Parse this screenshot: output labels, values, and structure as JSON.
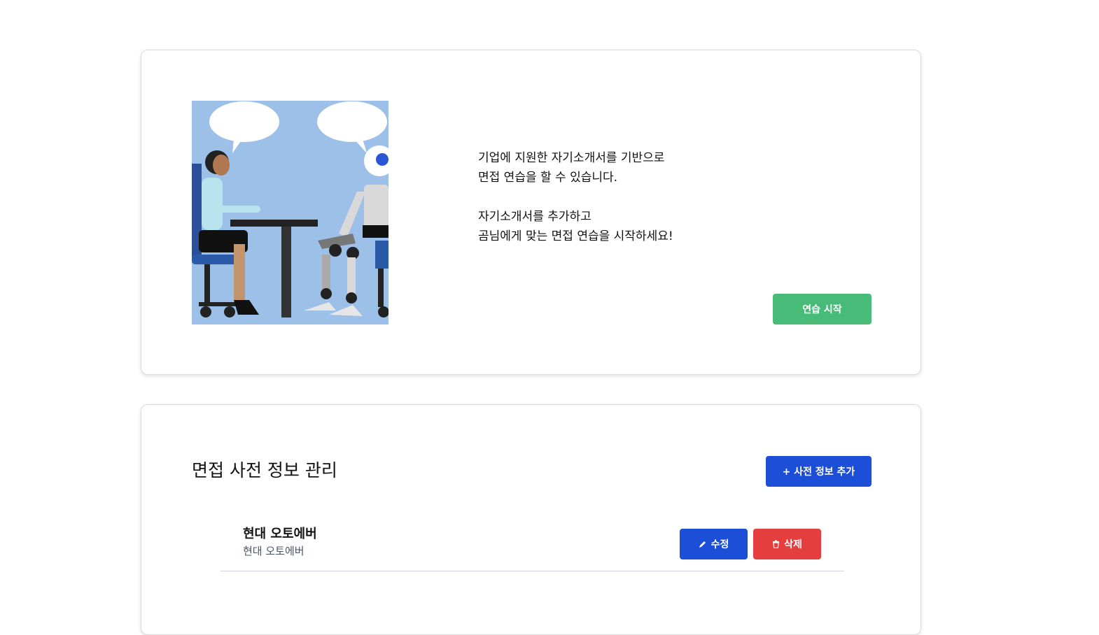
{
  "intro": {
    "illustration_alt": "interview-illustration",
    "lines": [
      "기업에 지원한 자기소개서를 기반으로",
      "면접 연습을 할 수 있습니다.",
      "자기소개서를 추가하고",
      "곰님에게 맞는 면접 연습을 시작하세요!"
    ],
    "start_button": "연습 시작"
  },
  "manage": {
    "title": "면접 사전 정보 관리",
    "add_button": "+ 사전 정보 추가",
    "entries": [
      {
        "title": "현대 오토에버",
        "subtitle": "현대 오토에버",
        "edit_label": "수정",
        "delete_label": "삭제"
      }
    ]
  },
  "colors": {
    "start": "#48bb78",
    "primary": "#1d4ed8",
    "danger": "#e53e3e"
  },
  "icons": {
    "edit": "pencil-icon",
    "delete": "trash-icon"
  }
}
